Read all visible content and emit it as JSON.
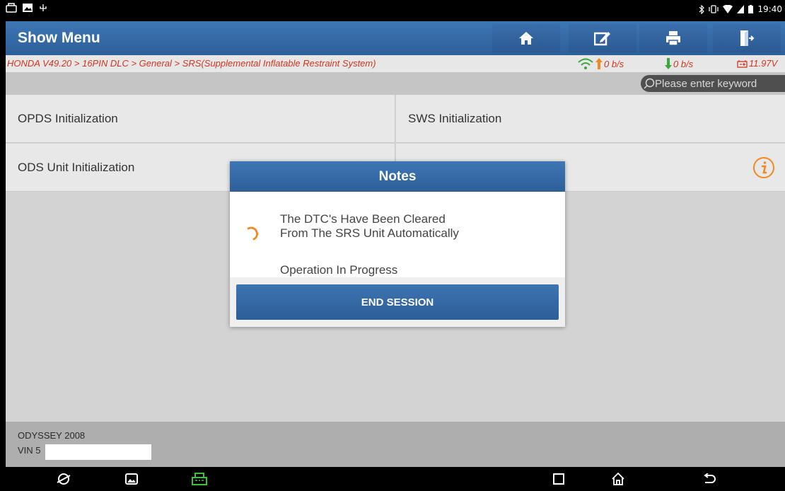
{
  "status_bar": {
    "time": "19:40",
    "left_icons": [
      "vci-icon",
      "image-icon",
      "usb-icon"
    ],
    "right_icons": [
      "bluetooth-icon",
      "vibrate-icon",
      "wifi-icon",
      "signal-icon",
      "battery-icon"
    ]
  },
  "header": {
    "title": "Show Menu",
    "buttons": [
      {
        "name": "home",
        "icon": "home-icon"
      },
      {
        "name": "edit",
        "icon": "edit-icon"
      },
      {
        "name": "print",
        "icon": "print-icon"
      },
      {
        "name": "exit",
        "icon": "exit-icon"
      }
    ]
  },
  "breadcrumb": {
    "path": "HONDA V49.20 > 16PIN DLC > General > SRS(Supplemental Inflatable Restraint System)",
    "upload_rate": "0 b/s",
    "download_rate": "0 b/s",
    "voltage": "11.97V"
  },
  "search": {
    "placeholder": "Please enter keyword"
  },
  "menu": {
    "items": [
      {
        "label": "OPDS Initialization"
      },
      {
        "label": "SWS Initialization"
      },
      {
        "label": "ODS Unit Initialization"
      }
    ]
  },
  "footer": {
    "model": "ODYSSEY 2008",
    "vin_label": "VIN 5"
  },
  "dialog": {
    "title": "Notes",
    "message_line1": "The DTC's Have Been Cleared",
    "message_line2": "From The SRS Unit Automatically",
    "progress_text": "Operation In Progress",
    "button_label": "END SESSION"
  },
  "colors": {
    "header_blue": "#2d5f98",
    "breadcrumb_red": "#d1341f",
    "accent_orange": "#f0891f",
    "wifi_green": "#3aa83a",
    "vci_green": "#3cc23c"
  }
}
